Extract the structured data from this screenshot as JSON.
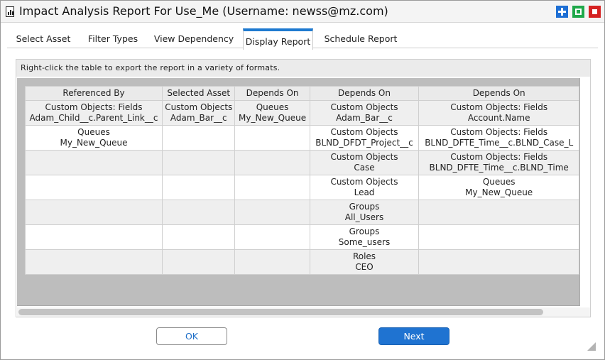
{
  "window": {
    "title": "Impact Analysis Report For Use_Me (Username: newss@mz.com)"
  },
  "tabs": [
    {
      "label": "Select Asset"
    },
    {
      "label": "Filter Types"
    },
    {
      "label": "View Dependency"
    },
    {
      "label": "Display Report"
    },
    {
      "label": "Schedule Report"
    }
  ],
  "active_tab": "Display Report",
  "hint": "Right-click the table to export the report in a variety of formats.",
  "table": {
    "columns": [
      "Referenced By",
      "Selected Asset",
      "Depends On",
      "Depends On",
      "Depends On"
    ],
    "rows": [
      [
        [
          "Custom Objects: Fields",
          "Adam_Child__c.Parent_Link__c"
        ],
        [
          "Custom Objects",
          "Adam_Bar__c"
        ],
        [
          "Queues",
          "My_New_Queue"
        ],
        [
          "Custom Objects",
          "Adam_Bar__c"
        ],
        [
          "Custom Objects: Fields",
          "Account.Name"
        ]
      ],
      [
        [
          "Queues",
          "My_New_Queue"
        ],
        [
          "",
          ""
        ],
        [
          "",
          ""
        ],
        [
          "Custom Objects",
          "BLND_DFDT_Project__c"
        ],
        [
          "Custom Objects: Fields",
          "BLND_DFTE_Time__c.BLND_Case_L"
        ]
      ],
      [
        [
          "",
          ""
        ],
        [
          "",
          ""
        ],
        [
          "",
          ""
        ],
        [
          "Custom Objects",
          "Case"
        ],
        [
          "Custom Objects: Fields",
          "BLND_DFTE_Time__c.BLND_Time"
        ]
      ],
      [
        [
          "",
          ""
        ],
        [
          "",
          ""
        ],
        [
          "",
          ""
        ],
        [
          "Custom Objects",
          "Lead"
        ],
        [
          "Queues",
          "My_New_Queue"
        ]
      ],
      [
        [
          "",
          ""
        ],
        [
          "",
          ""
        ],
        [
          "",
          ""
        ],
        [
          "Groups",
          "All_Users"
        ],
        [
          "",
          ""
        ]
      ],
      [
        [
          "",
          ""
        ],
        [
          "",
          ""
        ],
        [
          "",
          ""
        ],
        [
          "Groups",
          "Some_users"
        ],
        [
          "",
          ""
        ]
      ],
      [
        [
          "",
          ""
        ],
        [
          "",
          ""
        ],
        [
          "",
          ""
        ],
        [
          "Roles",
          "CEO"
        ],
        [
          "",
          ""
        ]
      ]
    ]
  },
  "buttons": {
    "ok": "OK",
    "next": "Next"
  },
  "colors": {
    "accent": "#1f73d1",
    "add_button": "#1e6fd4",
    "maximize_button": "#1fa84a",
    "close_button": "#d52222"
  },
  "icons": {
    "app": "report-chart-icon",
    "add": "plus-icon",
    "maximize": "maximize-icon",
    "close": "close-icon",
    "resize": "resize-grip-icon"
  }
}
